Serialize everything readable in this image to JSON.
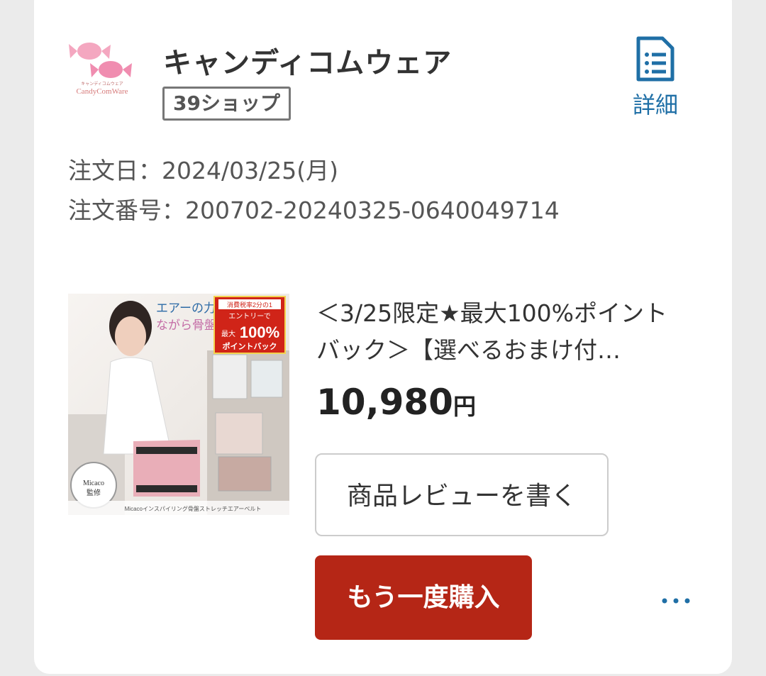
{
  "shop": {
    "logo_text": "CandyComWare",
    "logo_subtext": "キャンディコムウェア",
    "name": "キャンディコムウェア",
    "badge": "39ショップ",
    "details_label": "詳細",
    "details_icon": "document-list-icon"
  },
  "order": {
    "date_line": "注文日：2024/03/25(月)",
    "number_line": "注文番号：200702-20240325-0640049714"
  },
  "product": {
    "image_text": {
      "headline_1": "エアーの力",
      "headline_2": "ながら骨盤",
      "promo_small_1": "消費税率2分の1",
      "promo_small_2": "エントリーで",
      "promo_small_3": "最大",
      "promo_big": "100%",
      "promo_bottom": "ポイントバック",
      "badge_1": "Micaco",
      "badge_2": "監修",
      "caption": "Micacoインスパイリング骨盤ストレッチエアーベルト"
    },
    "title": "＜3/25限定★最大100%ポイントバック＞【選べるおまけ付…",
    "price_number": "10,980",
    "price_unit": "円"
  },
  "actions": {
    "review_label": "商品レビューを書く",
    "rebuy_label": "もう一度購入",
    "more_icon": "more-horizontal-icon"
  },
  "colors": {
    "accent_blue": "#1f6fa6",
    "rebuy_red": "#b52616"
  }
}
